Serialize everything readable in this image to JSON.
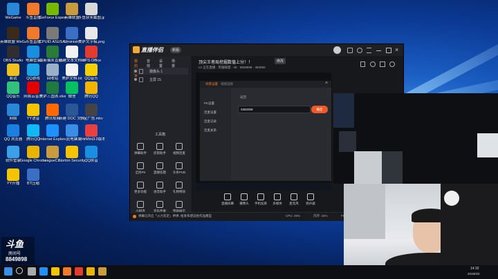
{
  "desktop_icons": [
    {
      "label": "WeGame",
      "color": "#2a86d6"
    },
    {
      "label": "斗鱼直播",
      "color": "#f07a2a"
    },
    {
      "label": "GeForce Experience",
      "color": "#76b900"
    },
    {
      "label": "英雄联盟",
      "color": "#c89b3c"
    },
    {
      "label": "斗鱼获奖截图.jpg",
      "color": "#d8d8d8"
    },
    {
      "label": "英雄联盟 WeGame版",
      "color": "#3a2a1a"
    },
    {
      "label": "斗鱼直播",
      "color": "#f07a2a"
    },
    {
      "label": "CPUID ASUS CPU-Z",
      "color": "#7a7a7a"
    },
    {
      "label": "Administr...",
      "color": "#3a6fc4"
    },
    {
      "label": "美萨文字稿.png",
      "color": "#e8e8e8"
    },
    {
      "label": "OBS Studio",
      "color": "#302e31"
    },
    {
      "label": "电脑管家",
      "color": "#1a8fe0"
    },
    {
      "label": "最新抽奖直播产品-022...",
      "color": "#2a7a3a"
    },
    {
      "label": "新建文本文档.txt",
      "color": "#f2f2f2"
    },
    {
      "label": "WPS Office",
      "color": "#e33b2e"
    },
    {
      "label": "面试",
      "color": "#f0c020"
    },
    {
      "label": "QQ游戏",
      "color": "#1aa3e8"
    },
    {
      "label": "回收站",
      "color": "#9ab0c8"
    },
    {
      "label": "美萨文档.txt",
      "color": "#f2f2f2"
    },
    {
      "label": "QQ音乐",
      "color": "#f5d000"
    },
    {
      "label": "QQ音乐",
      "color": "#31c27c"
    },
    {
      "label": "网易云音乐",
      "color": "#e20000"
    },
    {
      "label": "美萨三国表.xlsx",
      "color": "#1f7a40"
    },
    {
      "label": "微信",
      "color": "#07c160"
    },
    {
      "label": "腾讯QQ",
      "color": "#f5b400"
    },
    {
      "label": "网络",
      "color": "#2a86d6"
    },
    {
      "label": "YY语音",
      "color": "#f5c400"
    },
    {
      "label": "腾讯视频",
      "color": "#ff6a00"
    },
    {
      "label": "新建 DOC 文档.doc",
      "color": "#2b5797"
    },
    {
      "label": "小宝广告.mkv",
      "color": "#444444"
    },
    {
      "label": "QQ 浏览器",
      "color": "#1a7fe0"
    },
    {
      "label": "腾讯QQ",
      "color": "#12b7f5"
    },
    {
      "label": "Internet Explorer",
      "color": "#1e90ff"
    },
    {
      "label": "此电脑",
      "color": "#3a8ee6"
    },
    {
      "label": "翻带Mini3.0版本",
      "color": "#e84040"
    },
    {
      "label": "软件管家",
      "color": "#3aa0e8"
    },
    {
      "label": "Google Chrome",
      "color": "#e8b400"
    },
    {
      "label": "LeagueCli...",
      "color": "#c89b3c"
    },
    {
      "label": "Norton Security",
      "color": "#f5c400"
    },
    {
      "label": "QQ拼音",
      "color": "#1a8fe0"
    },
    {
      "label": "YY开播",
      "color": "#f5c400"
    },
    {
      "label": "BT压缩",
      "color": "#3a6fc4"
    }
  ],
  "brand": {
    "name": "斗鱼",
    "sub": "房间号",
    "room": "8849898"
  },
  "app": {
    "logo": "直播伴侣",
    "badge": "新版",
    "room_title": "顶尖王者局挖掘数值上分！！",
    "tag_edit": "修改",
    "meta": "LV 正在直播 · 英雄联盟 · 4K · 8849898 · 482050",
    "left_tabs": [
      "我的场景",
      "音效",
      "设置",
      "场景"
    ],
    "scenes": [
      "摄像头 1",
      "主屏 15"
    ],
    "tools_title": "工具箱",
    "tools": [
      "弹幕助手",
      "房管助手",
      "视频连麦",
      "全民PK",
      "直播答题",
      "头条PUB",
      "更多功能",
      "语音助手",
      "礼物特效",
      "小程序",
      "音乐伴奏",
      "赞助展示"
    ],
    "bottom_controls": [
      "直播屏幕",
      "摄像头",
      "手机投屏",
      "多媒体",
      "麦克风",
      "扬声器"
    ],
    "status_text": "弹幕已开启「火力充足」神弹, 给发布建议给作品模型",
    "status_right": [
      "CPU: 28%",
      "内存: 42%",
      "FPS: 60",
      "码率: 2.8M"
    ]
  },
  "dialog": {
    "tabs": [
      "场景设置",
      "视频选择"
    ],
    "side_items": [
      "PK设置",
      "连麦设置",
      "连麦记录",
      "连麦关系"
    ],
    "back": "返回",
    "input_value": "3392008",
    "confirm": "确定"
  },
  "taskbar": {
    "apps": [
      "start",
      "search",
      "task-view",
      "edge",
      "explorer",
      "douyu",
      "wps",
      "chrome",
      "lol"
    ],
    "time": "14:32",
    "date": "2019/4/2"
  }
}
